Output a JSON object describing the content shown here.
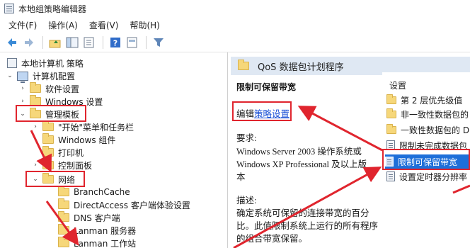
{
  "window": {
    "title": "本地组策略编辑器"
  },
  "menu": [
    {
      "label": "文件(F)"
    },
    {
      "label": "操作(A)"
    },
    {
      "label": "查看(V)"
    },
    {
      "label": "帮助(H)"
    }
  ],
  "tree": {
    "root": "本地计算机 策略",
    "computer_config": "计算机配置",
    "software_settings": "软件设置",
    "windows_settings": "Windows 设置",
    "admin_templates": "管理模板",
    "start_menu": "\"开始\"菜单和任务栏",
    "windows_components": "Windows 组件",
    "printers": "打印机",
    "control_panel": "控制面板",
    "network": "网络",
    "branchcache": "BranchCache",
    "directaccess": "DirectAccess 客户端体验设置",
    "dns_client": "DNS 客户端",
    "lanman_server": "Lanman 服务器",
    "lanman_workstation": "Lanman 工作站"
  },
  "right": {
    "header": "QoS 数据包计划程序",
    "policy_title": "限制可保留带宽",
    "edit_prefix": "编辑",
    "edit_link": "策略设置",
    "requirements_label": "要求:",
    "requirements_lines": [
      "Windows Server 2003 操作系统或",
      "Windows XP Professional 及以上版",
      "本"
    ],
    "description_label": "描述:",
    "description_lines": [
      "确定系统可保留的连接带宽的百分",
      "比。此值限制系统上运行的所有程序",
      "的组合带宽保留。"
    ],
    "settings_header": "设置",
    "settings_items": [
      {
        "label": "第 2 层优先级值",
        "kind": "folder"
      },
      {
        "label": "非一致性数据包的",
        "kind": "folder"
      },
      {
        "label": "一致性数据包的 D",
        "kind": "folder"
      },
      {
        "label": "限制未完成数据包",
        "kind": "setting"
      },
      {
        "label": "限制可保留带宽",
        "kind": "setting",
        "selected": true
      },
      {
        "label": "设置定时器分辨率",
        "kind": "setting"
      }
    ]
  },
  "colors": {
    "annotation": "#e0252e",
    "selection": "#1e6fd9",
    "link": "#1a4fd6"
  }
}
